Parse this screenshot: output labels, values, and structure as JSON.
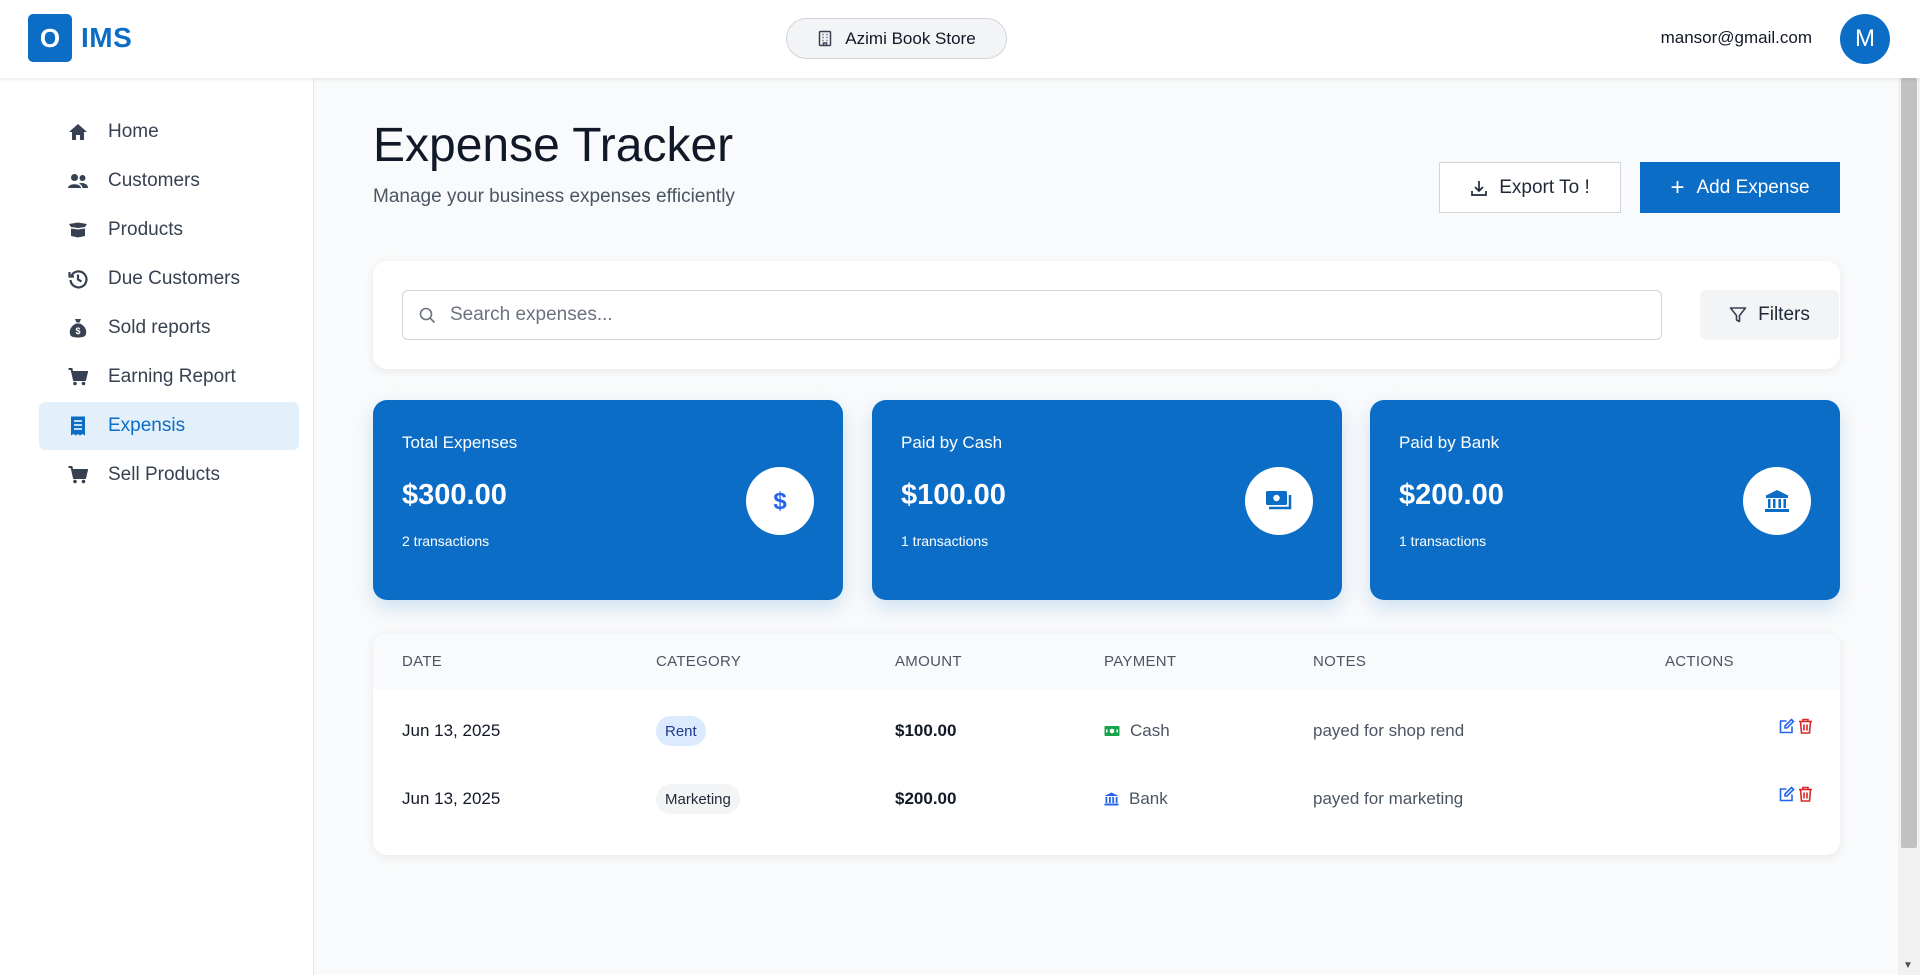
{
  "header": {
    "logo_letter": "O",
    "app_name": "IMS",
    "store_name": "Azimi Book Store",
    "user_email": "mansor@gmail.com",
    "avatar_letter": "M"
  },
  "sidebar": {
    "items": [
      {
        "label": "Home",
        "icon": "home-icon"
      },
      {
        "label": "Customers",
        "icon": "users-icon"
      },
      {
        "label": "Products",
        "icon": "box-icon"
      },
      {
        "label": "Due Customers",
        "icon": "history-icon"
      },
      {
        "label": "Sold reports",
        "icon": "money-bag-icon"
      },
      {
        "label": "Earning Report",
        "icon": "cart-icon"
      },
      {
        "label": "Expensis",
        "icon": "receipt-icon",
        "active": true
      },
      {
        "label": "Sell Products",
        "icon": "cart-icon"
      }
    ]
  },
  "page": {
    "title": "Expense Tracker",
    "subtitle": "Manage your business expenses efficiently",
    "export_label": "Export To !",
    "add_label": "Add Expense"
  },
  "search": {
    "placeholder": "Search expenses...",
    "value": "",
    "filters_label": "Filters"
  },
  "stats": [
    {
      "label": "Total Expenses",
      "value": "$300.00",
      "count": "2 transactions",
      "icon": "dollar-icon"
    },
    {
      "label": "Paid by Cash",
      "value": "$100.00",
      "count": "1 transactions",
      "icon": "cash-icon"
    },
    {
      "label": "Paid by Bank",
      "value": "$200.00",
      "count": "1 transactions",
      "icon": "bank-icon"
    }
  ],
  "table": {
    "headers": [
      "DATE",
      "CATEGORY",
      "AMOUNT",
      "PAYMENT",
      "NOTES",
      "ACTIONS"
    ],
    "rows": [
      {
        "date": "Jun 13, 2025",
        "category": "Rent",
        "amount": "$100.00",
        "payment": "Cash",
        "notes": "payed for shop rend"
      },
      {
        "date": "Jun 13, 2025",
        "category": "Marketing",
        "amount": "$200.00",
        "payment": "Bank",
        "notes": "payed for marketing"
      }
    ]
  },
  "colors": {
    "primary": "#0b6dc5",
    "rent_badge": "#dbeafe",
    "cash_icon": "#16a34a",
    "bank_icon": "#2563eb",
    "delete_icon": "#dc2626"
  }
}
